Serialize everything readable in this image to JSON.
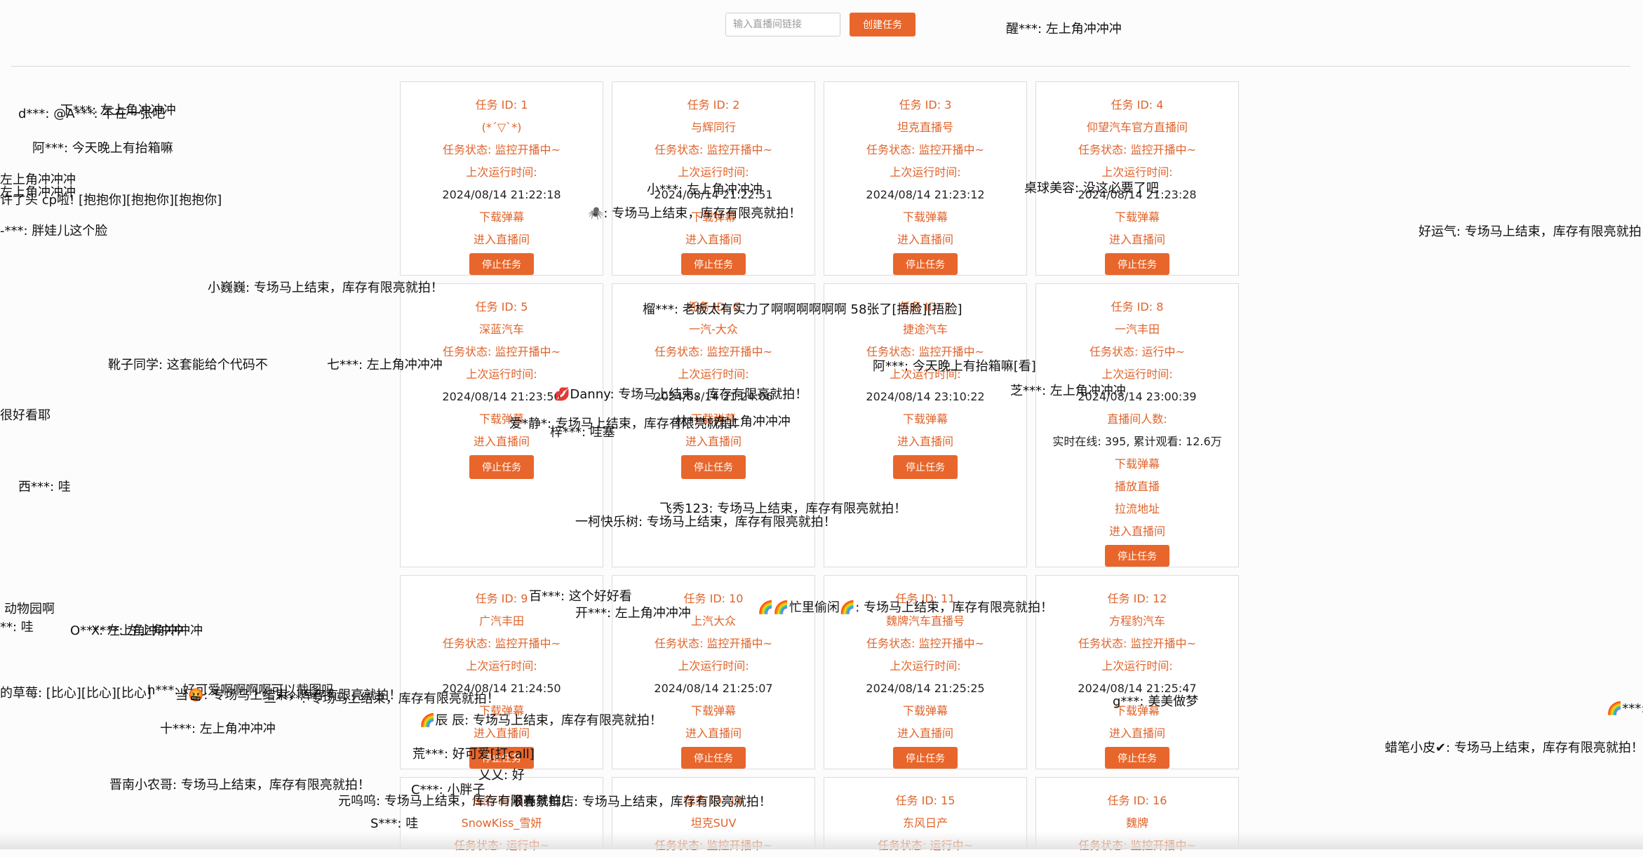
{
  "header": {
    "url_placeholder": "输入直播间链接",
    "create_label": "创建任务"
  },
  "tasks": [
    {
      "id_label": "任务 ID: 1",
      "name": "(*´▽`*)",
      "status": "任务状态: 监控开播中~",
      "last_run_label": "上次运行时间:",
      "last_run": "2024/08/14 21:22:18",
      "download": "下载弹幕",
      "enter": "进入直播间",
      "stop": "停止任务"
    },
    {
      "id_label": "任务 ID: 2",
      "name": "与辉同行",
      "status": "任务状态: 监控开播中~",
      "last_run_label": "上次运行时间:",
      "last_run": "2024/08/14 21:22:51",
      "download": "下载弹幕",
      "enter": "进入直播间",
      "stop": "停止任务"
    },
    {
      "id_label": "任务 ID: 3",
      "name": "坦克直播号",
      "status": "任务状态: 监控开播中~",
      "last_run_label": "上次运行时间:",
      "last_run": "2024/08/14 21:23:12",
      "download": "下载弹幕",
      "enter": "进入直播间",
      "stop": "停止任务"
    },
    {
      "id_label": "任务 ID: 4",
      "name": "仰望汽车官方直播间",
      "status": "任务状态: 监控开播中~",
      "last_run_label": "上次运行时间:",
      "last_run": "2024/08/14 21:23:28",
      "download": "下载弹幕",
      "enter": "进入直播间",
      "stop": "停止任务"
    },
    {
      "id_label": "任务 ID: 5",
      "name": "深蓝汽车",
      "status": "任务状态: 监控开播中~",
      "last_run_label": "上次运行时间:",
      "last_run": "2024/08/14 21:23:50",
      "download": "下载弹幕",
      "enter": "进入直播间",
      "stop": "停止任务"
    },
    {
      "id_label": "任务 ID: 6",
      "name": "一汽-大众",
      "status": "任务状态: 监控开播中~",
      "last_run_label": "上次运行时间:",
      "last_run": "2024/08/14 21:24:06",
      "download": "下载弹幕",
      "enter": "进入直播间",
      "stop": "停止任务"
    },
    {
      "id_label": "任务 ID: 7",
      "name": "捷途汽车",
      "status": "任务状态: 监控开播中~",
      "last_run_label": "上次运行时间:",
      "last_run": "2024/08/14 23:10:22",
      "download": "下载弹幕",
      "enter": "进入直播间",
      "stop": "停止任务"
    },
    {
      "id_label": "任务 ID: 8",
      "name": "一汽丰田",
      "status": "任务状态: 运行中~",
      "last_run_label": "上次运行时间:",
      "last_run": "2024/08/14 23:00:39",
      "viewers_label": "直播间人数:",
      "viewers": "实时在线: 395, 累计观看: 12.6万",
      "download": "下载弹幕",
      "play": "播放直播",
      "pull": "拉流地址",
      "enter": "进入直播间",
      "stop": "停止任务"
    },
    {
      "id_label": "任务 ID: 9",
      "name": "广汽丰田",
      "status": "任务状态: 监控开播中~",
      "last_run_label": "上次运行时间:",
      "last_run": "2024/08/14 21:24:50",
      "download": "下载弹幕",
      "enter": "进入直播间",
      "stop": "停止任务"
    },
    {
      "id_label": "任务 ID: 10",
      "name": "上汽大众",
      "status": "任务状态: 监控开播中~",
      "last_run_label": "上次运行时间:",
      "last_run": "2024/08/14 21:25:07",
      "download": "下载弹幕",
      "enter": "进入直播间",
      "stop": "停止任务"
    },
    {
      "id_label": "任务 ID: 11",
      "name": "魏牌汽车直播号",
      "status": "任务状态: 监控开播中~",
      "last_run_label": "上次运行时间:",
      "last_run": "2024/08/14 21:25:25",
      "download": "下载弹幕",
      "enter": "进入直播间",
      "stop": "停止任务"
    },
    {
      "id_label": "任务 ID: 12",
      "name": "方程豹汽车",
      "status": "任务状态: 监控开播中~",
      "last_run_label": "上次运行时间:",
      "last_run": "2024/08/14 21:25:47",
      "download": "下载弹幕",
      "enter": "进入直播间",
      "stop": "停止任务"
    },
    {
      "id_label": "任务 ID: 13",
      "name": "SnowKiss_雪妍",
      "status": "任务状态: 运行中~"
    },
    {
      "id_label": "任务 ID: 14",
      "name": "坦克SUV",
      "status": "任务状态: 监控开播中~"
    },
    {
      "id_label": "任务 ID: 15",
      "name": "东风日产",
      "status": "任务状态: 运行中~"
    },
    {
      "id_label": "任务 ID: 16",
      "name": "魏牌",
      "status": "任务状态: 监控开播中~"
    }
  ],
  "danmaku": [
    "醒***: 左上角冲冲冲",
    "下***: 左上角冲冲冲",
    "d***: @A***: 不在一张吧",
    "阿***: 今天晚上有抬箱嘛",
    "左上角冲冲冲",
    "左上角冲冲冲",
    "许了头 cp啦! [抱抱你][抱抱你][抱抱你]",
    "-***: 胖娃儿这个脸",
    "小***: 左上角冲冲冲",
    "🕷️: 专场马上结束，库存有限亮就拍！",
    "桌球美容: 没这必要了吧",
    "好运气: 专场马上结束，库存有限亮就拍！",
    "小巍巍: 专场马上结束，库存有限亮就拍！",
    "榴***: 老板太有实力了啊啊啊啊啊啊 58张了[捂脸][捂脸]",
    "靴子同学: 这套能给个代码不",
    "七***: 左上角冲冲冲",
    "阿***: 今天晚上有抬箱嘛[看]",
    "芝***: 左上角冲冲冲",
    "💋Danny: 专场马上结束，库存有限亮就拍！",
    "很好看耶",
    "爱*静*: 专场马上结束，库存有限亮就拍！",
    "林***: 左上角冲冲冲",
    "梓***: 哇塞",
    "西***: 哇",
    "飞秀123: 专场马上结束，库存有限亮就拍！",
    "一柯快乐树: 专场马上结束，库存有限亮就拍！",
    "百***: 这个好好看",
    "开***: 左上角冲冲冲",
    "🌈🌈忙里偷闲🌈: 专场马上结束，库存有限亮就拍！",
    "动物园啊",
    "**: 哇",
    "O***: 左上角冲冲冲",
    "X***: 左上角冲冲冲",
    "的草莓: [比心][比心][比心]",
    "h***: 好可爱啊啊啊啊可以截图吗",
    "当🤬: 专场马上结束，库存有限亮就拍！",
    "三****: 专场马上结束，库存有限亮就拍！",
    "g***: 美美做梦",
    "🌈***:",
    "🌈辰 辰: 专场马上结束，库存有限亮就拍！",
    "十***: 左上角冲冲冲",
    "荒***: 好可爱[打call]",
    "蜡笔小皮✔: 专场马上结束，库存有限亮就拍！",
    "乂乂: 好",
    "晋南小农哥: 专场马上结束，库存有限亮就拍！",
    "C***: 小胖子",
    "元呜呜: 专场马上结束，库存有限亮就拍！",
    "顺春景鲜店: 专场马上结束，库存有限亮就拍！",
    "S***: 哇"
  ]
}
